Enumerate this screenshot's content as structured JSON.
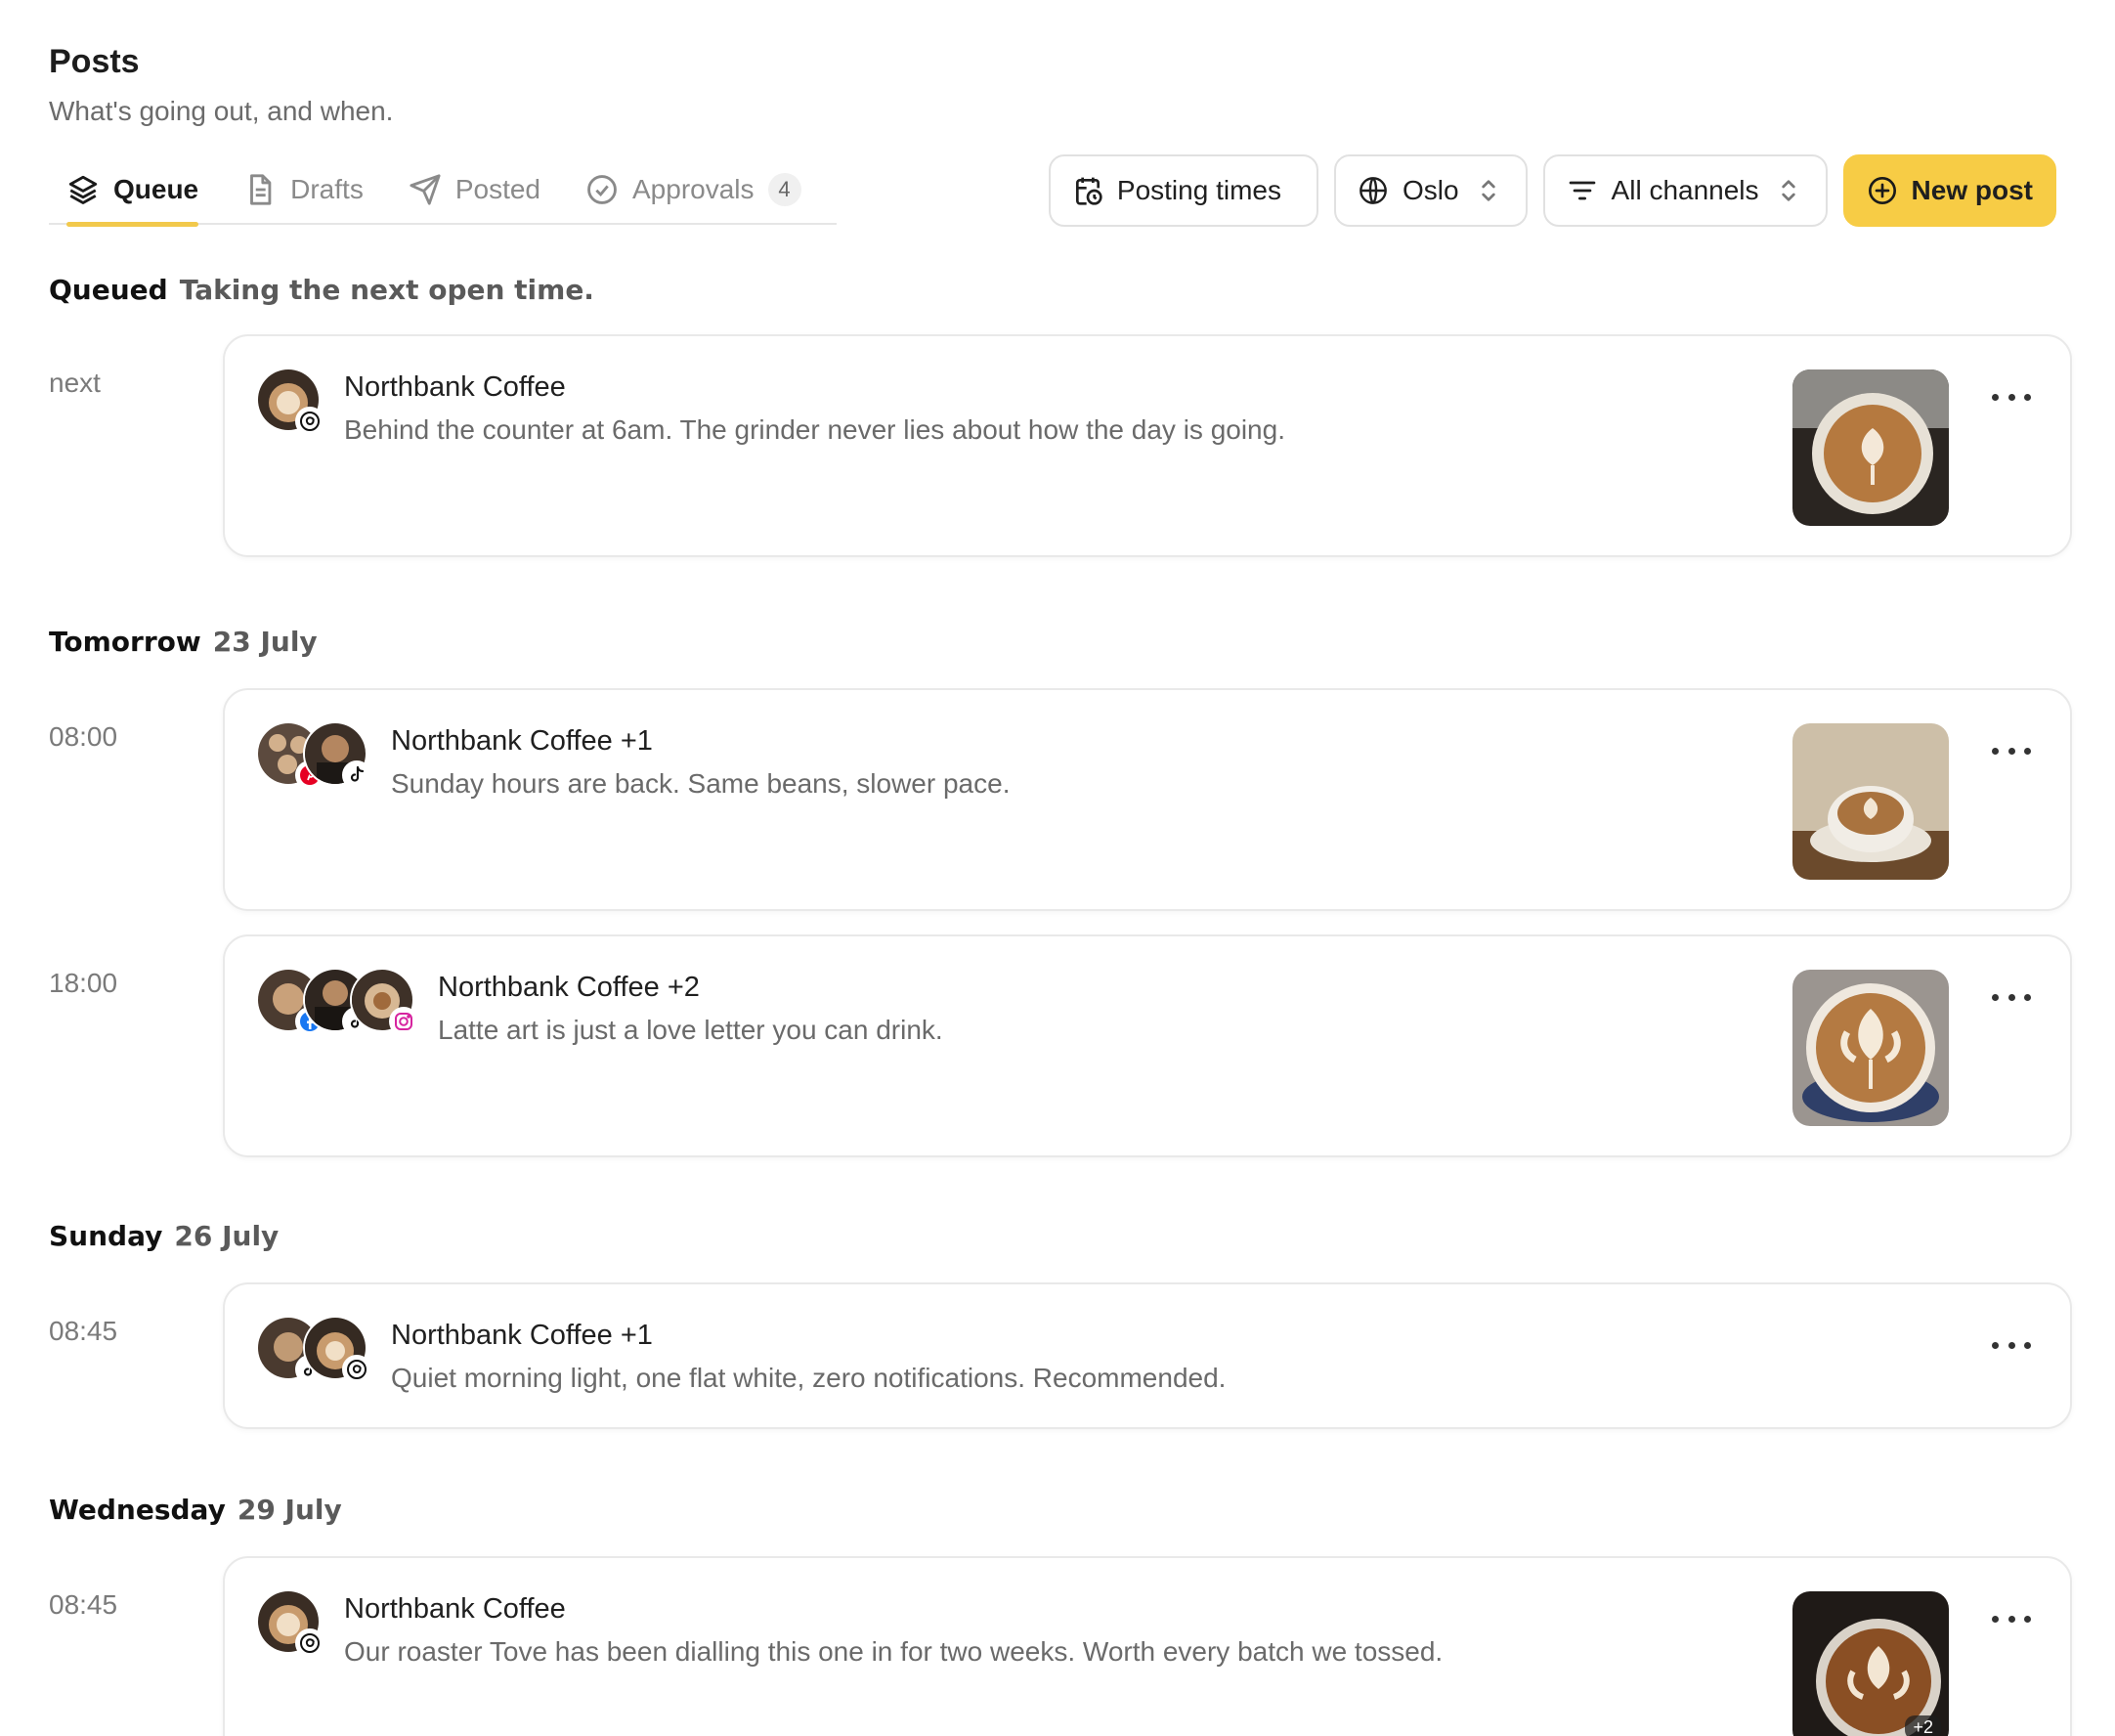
{
  "header": {
    "title": "Posts",
    "subtitle": "What's going out, and when."
  },
  "tabs": [
    {
      "label": "Queue",
      "icon": "layers-icon",
      "active": true
    },
    {
      "label": "Drafts",
      "icon": "document-icon",
      "active": false
    },
    {
      "label": "Posted",
      "icon": "send-icon",
      "active": false
    },
    {
      "label": "Approvals",
      "icon": "check-circle-icon",
      "active": false,
      "badge": "4"
    }
  ],
  "controls": {
    "posting_times": "Posting times",
    "timezone": "Oslo",
    "channels": "All channels",
    "new_post": "New post"
  },
  "sections": [
    {
      "strong": "Queued",
      "soft": "Taking the next open time."
    },
    {
      "strong": "Tomorrow",
      "soft": "23 July"
    },
    {
      "strong": "Sunday",
      "soft": "26 July"
    },
    {
      "strong": "Wednesday",
      "soft": "29 July"
    }
  ],
  "posts": [
    {
      "slot": "next",
      "account": "Northbank Coffee",
      "text": "Behind the counter at 6am. The grinder never lies about how the day is going.",
      "networks": [
        "threads"
      ],
      "has_thumb": true
    },
    {
      "slot": "08:00",
      "account": "Northbank Coffee +1",
      "text": "Sunday hours are back. Same beans, slower pace.",
      "networks": [
        "pinterest",
        "tiktok"
      ],
      "has_thumb": true
    },
    {
      "slot": "18:00",
      "account": "Northbank Coffee +2",
      "text": "Latte art is just a love letter you can drink.",
      "networks": [
        "facebook",
        "tiktok",
        "instagram"
      ],
      "has_thumb": true
    },
    {
      "slot": "08:45",
      "account": "Northbank Coffee +1",
      "text": "Quiet morning light, one flat white, zero notifications. Recommended.",
      "networks": [
        "tiktok",
        "threads"
      ],
      "has_thumb": false
    },
    {
      "slot": "08:45",
      "account": "Northbank Coffee",
      "text": "Our roaster Tove has been dialling this one in for two weeks. Worth every batch we tossed.",
      "networks": [
        "threads"
      ],
      "has_thumb": true,
      "thumb_extra": "+2"
    }
  ],
  "colors": {
    "accent": "#f7cc45",
    "instagram": "#d6249f",
    "pinterest": "#e60023",
    "facebook": "#1877f2"
  }
}
